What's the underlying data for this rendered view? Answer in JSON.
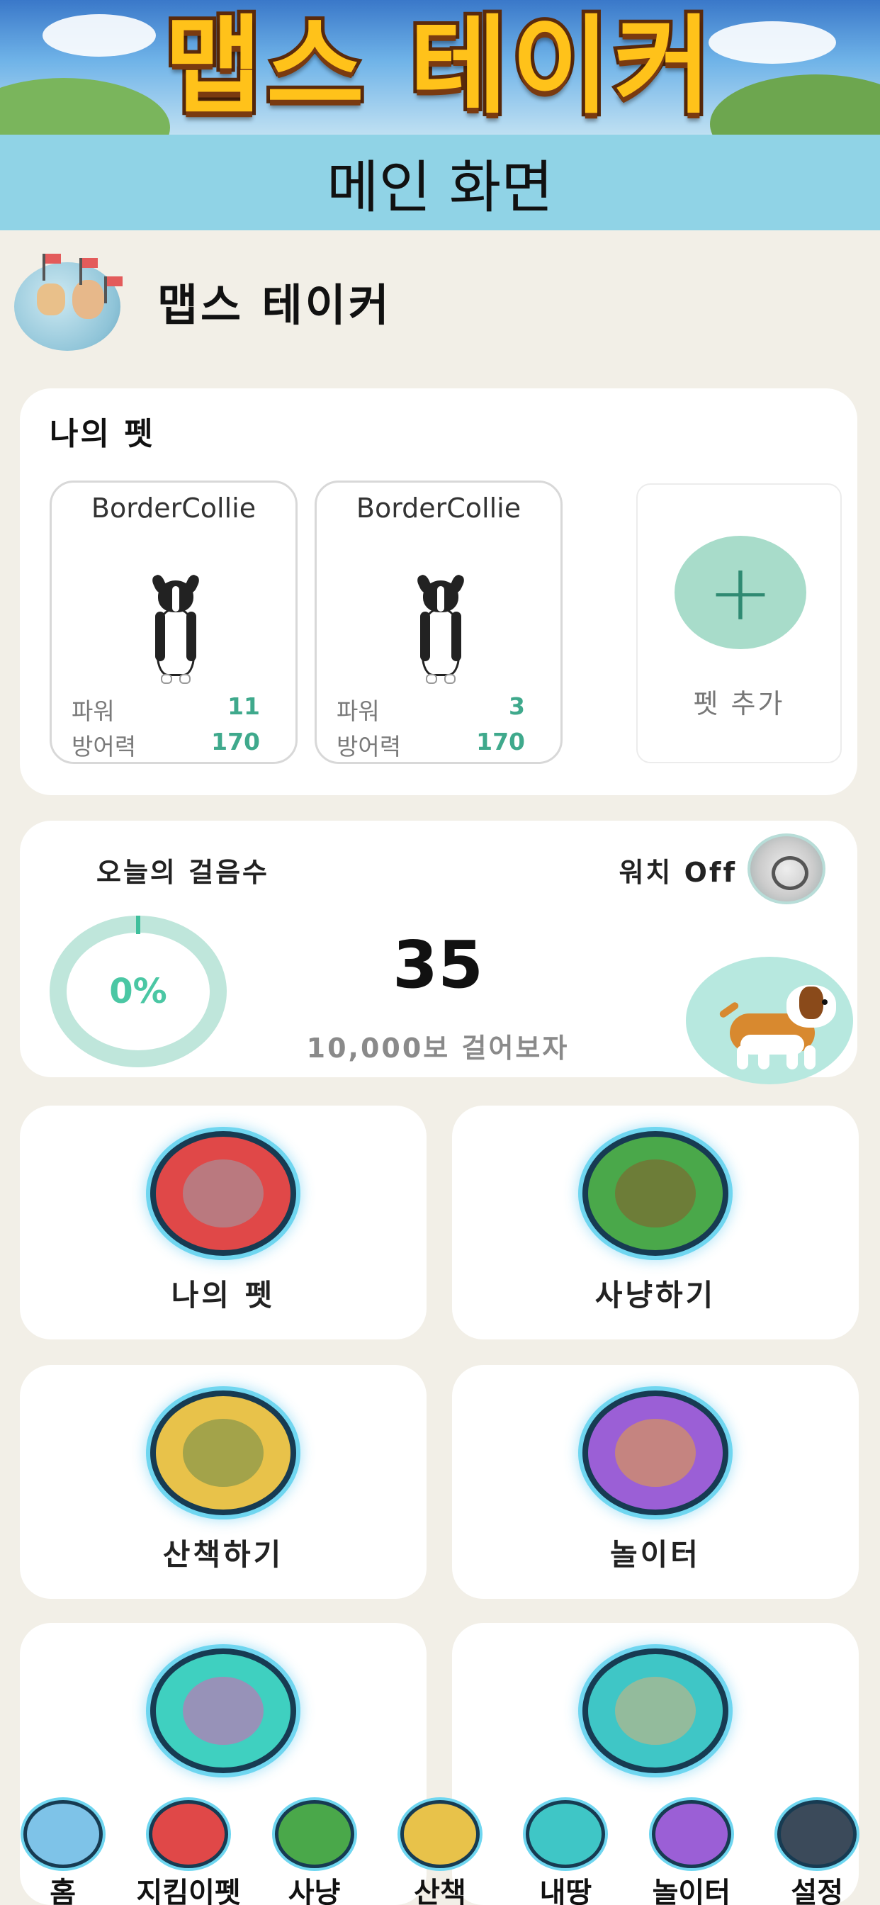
{
  "banner": {
    "logo_text": "맵스 테이커"
  },
  "header": {
    "title": "메인 화면"
  },
  "user": {
    "name": "맵스 테이커"
  },
  "my_pets": {
    "title": "나의 펫",
    "pets": [
      {
        "name": "BorderCollie",
        "power_label": "파워",
        "power": "11",
        "defense_label": "방어력",
        "defense": "170"
      },
      {
        "name": "BorderCollie",
        "power_label": "파워",
        "power": "3",
        "defense_label": "방어력",
        "defense": "170"
      }
    ],
    "add_symbol": "+",
    "add_label": "펫 추가"
  },
  "steps": {
    "title": "오늘의 걸음수",
    "watch_label": "워치 Off",
    "progress_text": "0%",
    "progress": 0,
    "count": "35",
    "goal_text": "10,000보 걸어보자"
  },
  "menu": [
    {
      "label": "나의 펫",
      "icon": "husky-icon",
      "color": "#e04848"
    },
    {
      "label": "사냥하기",
      "icon": "crossbow-icon",
      "color": "#4aa84a"
    },
    {
      "label": "산책하기",
      "icon": "hiker-icon",
      "color": "#e8c24a"
    },
    {
      "label": "놀이터",
      "icon": "playground-icon",
      "color": "#9b5fd6"
    },
    {
      "label": "",
      "icon": "world-map-icon",
      "color": "#3fd0c0"
    },
    {
      "label": "",
      "icon": "treasure-map-icon",
      "color": "#3fc6c6"
    }
  ],
  "nav": [
    {
      "label": "홈",
      "icon": "home-icon",
      "color": "#7ec3e8"
    },
    {
      "label": "지킴이펫",
      "icon": "guard-pet-icon",
      "color": "#e04848"
    },
    {
      "label": "사냥",
      "icon": "crossbow-icon",
      "color": "#4aa84a"
    },
    {
      "label": "산책",
      "icon": "hiker-icon",
      "color": "#e8c24a"
    },
    {
      "label": "내땅",
      "icon": "land-map-icon",
      "color": "#3fc6c6"
    },
    {
      "label": "놀이터",
      "icon": "playground-icon",
      "color": "#9b5fd6"
    },
    {
      "label": "설정",
      "icon": "settings-icon",
      "color": "#3b4a5a"
    }
  ]
}
